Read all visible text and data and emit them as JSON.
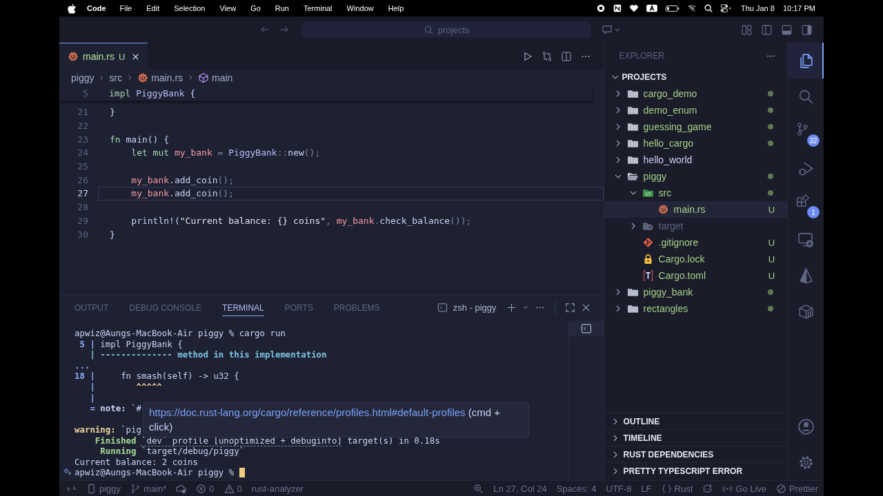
{
  "menu_bar": {
    "app": "Code",
    "items": [
      "File",
      "Edit",
      "Selection",
      "View",
      "Go",
      "Run",
      "Terminal",
      "Window",
      "Help"
    ],
    "date": "Thu Jan 8",
    "time": "10:17 PM"
  },
  "title_bar": {
    "search": "projects"
  },
  "editor_tabs": [
    {
      "label": "main.rs",
      "badge": "U",
      "kind": "rust",
      "selected": true
    }
  ],
  "breadcrumb": [
    {
      "label": "piggy",
      "kind": "folder"
    },
    {
      "label": "src",
      "kind": "folder"
    },
    {
      "label": "main.rs",
      "kind": "rust"
    },
    {
      "label": "main",
      "kind": "symbol"
    }
  ],
  "editor": {
    "sticky": {
      "number": "5",
      "tokens": [
        {
          "text": "impl ",
          "kind": "kw"
        },
        {
          "text": "PiggyBank",
          "kind": "type"
        },
        {
          "text": " {",
          "kind": "text"
        }
      ]
    },
    "lines": [
      {
        "number": "21",
        "current": false,
        "tokens": [
          {
            "text": "}",
            "kind": "text"
          }
        ]
      },
      {
        "number": "22",
        "current": false
      },
      {
        "number": "23",
        "current": false,
        "tokens": [
          {
            "text": "fn ",
            "kind": "kw"
          },
          {
            "text": "main",
            "kind": "fn"
          },
          {
            "text": "() {",
            "kind": "text"
          }
        ]
      },
      {
        "number": "24",
        "current": false,
        "tokens": [
          {
            "text": "    let mut ",
            "kind": "kw"
          },
          {
            "text": "my_bank",
            "kind": "var"
          },
          {
            "text": " = ",
            "kind": "punct"
          },
          {
            "text": "PiggyBank",
            "kind": "type"
          },
          {
            "text": "::",
            "kind": "punct"
          },
          {
            "text": "new",
            "kind": "fn"
          },
          {
            "text": "();",
            "kind": "punct"
          }
        ]
      },
      {
        "number": "25",
        "current": false
      },
      {
        "number": "26",
        "current": false,
        "tokens": [
          {
            "text": "    my_bank",
            "kind": "var"
          },
          {
            "text": ".add_coin",
            "kind": "fn"
          },
          {
            "text": "();",
            "kind": "punct"
          }
        ]
      },
      {
        "number": "27",
        "current": true,
        "tokens": [
          {
            "text": "    my_bank",
            "kind": "var"
          },
          {
            "text": ".add_coin",
            "kind": "fn"
          },
          {
            "text": "();",
            "kind": "punct"
          }
        ]
      },
      {
        "number": "28",
        "current": false
      },
      {
        "number": "29",
        "current": false,
        "tokens": [
          {
            "text": "    println!",
            "kind": "fn"
          },
          {
            "text": "(",
            "kind": "text"
          },
          {
            "text": "\"Current balance: {} coins\"",
            "kind": "str"
          },
          {
            "text": ", ",
            "kind": "punct"
          },
          {
            "text": "my_bank",
            "kind": "var"
          },
          {
            "text": ".",
            "kind": "punct"
          },
          {
            "text": "check_balance",
            "kind": "fn"
          },
          {
            "text": "());",
            "kind": "punct"
          }
        ]
      },
      {
        "number": "30",
        "current": false,
        "tokens": [
          {
            "text": "}",
            "kind": "text"
          }
        ]
      }
    ]
  },
  "panel": {
    "tabs": [
      {
        "label": "OUTPUT",
        "selected": false
      },
      {
        "label": "DEBUG CONSOLE",
        "selected": false
      },
      {
        "label": "TERMINAL",
        "selected": true
      },
      {
        "label": "PORTS",
        "selected": false
      },
      {
        "label": "PROBLEMS",
        "selected": false
      }
    ],
    "terminal_name": "zsh - piggy",
    "lines": [
      {
        "tokens": [
          {
            "text": "apwiz@Aungs-MacBook-Air piggy % cargo run",
            "kind": "text"
          }
        ]
      },
      {
        "tokens": [
          {
            "text": " 5 |",
            "kind": "gutter"
          },
          {
            "text": " impl PiggyBank {",
            "kind": "text"
          }
        ]
      },
      {
        "tokens": [
          {
            "text": "   | -------------- method in this implementation",
            "kind": "label"
          }
        ]
      },
      {
        "tokens": [
          {
            "text": "...",
            "kind": "gutter"
          }
        ]
      },
      {
        "tokens": [
          {
            "text": "18 |",
            "kind": "gutter"
          },
          {
            "text": "     fn smash(self) -> u32 {",
            "kind": "text"
          }
        ]
      },
      {
        "tokens": [
          {
            "text": "   |",
            "kind": "gutter"
          },
          {
            "text": "        ^^^^^",
            "kind": "caret"
          }
        ]
      },
      {
        "tokens": [
          {
            "text": "   |",
            "kind": "gutter"
          }
        ]
      },
      {
        "tokens": [
          {
            "text": "   =",
            "kind": "gutter"
          },
          {
            "text": " note:",
            "kind": "note"
          },
          {
            "text": " `#",
            "kind": "text"
          }
        ]
      },
      {
        "blank_before": true,
        "tokens": [
          {
            "text": "warning:",
            "kind": "warn"
          },
          {
            "text": " `pig",
            "kind": "text"
          }
        ]
      },
      {
        "tokens": [
          {
            "text": "    Finished ",
            "kind": "status"
          },
          {
            "text": "`dev` profile [unoptimized + debuginfo]",
            "kind": "hover"
          },
          {
            "text": " target(s) in 0.18s",
            "kind": "text"
          }
        ]
      },
      {
        "tokens": [
          {
            "text": "     Running",
            "kind": "status"
          },
          {
            "text": " `target/debug/piggy`",
            "kind": "text"
          }
        ]
      },
      {
        "tokens": [
          {
            "text": "Current balance: 2 coins",
            "kind": "text"
          }
        ]
      },
      {
        "tokens": [
          {
            "text": "apwiz@Aungs-MacBook-Air piggy % ",
            "kind": "text"
          }
        ],
        "cursor": true
      }
    ],
    "hover": {
      "link": "https://doc.rust-lang.org/cargo/reference/profiles.html#default-profiles",
      "hint": "(cmd + click)"
    }
  },
  "sidebar": {
    "title": "EXPLORER",
    "section": "PROJECTS",
    "tree": [
      {
        "name": "cargo_demo",
        "kind": "folder",
        "expanded": false,
        "selected": false,
        "modified": true
      },
      {
        "name": "demo_enum",
        "kind": "folder",
        "expanded": false,
        "selected": false,
        "modified": true
      },
      {
        "name": "guessing_game",
        "kind": "folder",
        "expanded": false,
        "selected": false,
        "modified": true
      },
      {
        "name": "hello_cargo",
        "kind": "folder",
        "expanded": false,
        "selected": false,
        "modified": true
      },
      {
        "name": "hello_world",
        "kind": "folder",
        "expanded": false,
        "selected": false
      },
      {
        "name": "piggy",
        "kind": "folder",
        "expanded": true,
        "selected": false,
        "modified": true,
        "children": [
          {
            "name": "src",
            "kind": "src",
            "expanded": true,
            "selected": false,
            "modified": true,
            "children": [
              {
                "name": "main.rs",
                "kind": "rust",
                "selected": true,
                "untracked": true,
                "badge": "U"
              }
            ]
          },
          {
            "name": "target",
            "kind": "target",
            "expanded": false,
            "selected": false,
            "ignored": true
          },
          {
            "name": ".gitignore",
            "kind": "git",
            "selected": false,
            "untracked": true,
            "badge": "U"
          },
          {
            "name": "Cargo.lock",
            "kind": "lock",
            "selected": false,
            "untracked": true,
            "badge": "U"
          },
          {
            "name": "Cargo.toml",
            "kind": "toml",
            "selected": false,
            "untracked": true,
            "badge": "U"
          }
        ]
      },
      {
        "name": "piggy_bank",
        "kind": "folder",
        "expanded": false,
        "selected": false,
        "modified": true
      },
      {
        "name": "rectangles",
        "kind": "folder",
        "expanded": false,
        "selected": false,
        "modified": true
      }
    ],
    "sections": [
      {
        "label": "OUTLINE",
        "expanded": false
      },
      {
        "label": "TIMELINE",
        "expanded": false
      },
      {
        "label": "RUST DEPENDENCIES",
        "expanded": false
      },
      {
        "label": "PRETTY TYPESCRIPT ERROR",
        "expanded": false
      }
    ]
  },
  "activity_bar": {
    "top": [
      {
        "kind": "explorer",
        "selected": true
      },
      {
        "kind": "search",
        "selected": false
      },
      {
        "kind": "scm",
        "selected": false,
        "badge": "32"
      },
      {
        "kind": "debug",
        "selected": false
      },
      {
        "kind": "extensions",
        "selected": false,
        "badge": "1"
      },
      {
        "kind": "remote",
        "selected": false
      },
      {
        "kind": "pyramid",
        "selected": false
      },
      {
        "kind": "box",
        "selected": false
      }
    ],
    "bottom": [
      {
        "kind": "account",
        "selected": false
      },
      {
        "kind": "settings",
        "selected": false
      }
    ]
  },
  "status_bar": {
    "left": [
      {
        "kind": "remote"
      },
      {
        "kind": "device",
        "text": "piggy"
      },
      {
        "kind": "branch",
        "text": "main*"
      },
      {
        "kind": "sync"
      },
      {
        "kind": "error",
        "text": "0"
      },
      {
        "kind": "warning",
        "text": "0"
      },
      {
        "kind": "plain",
        "text": "rust-analyzer"
      }
    ],
    "right": [
      {
        "kind": "zoom"
      },
      {
        "kind": "plain",
        "text": "Ln 27, Col 24"
      },
      {
        "kind": "plain",
        "text": "Spaces: 4"
      },
      {
        "kind": "plain",
        "text": "UTF-8"
      },
      {
        "kind": "plain",
        "text": "LF"
      },
      {
        "kind": "braces",
        "text": "Rust"
      },
      {
        "kind": "copilot"
      },
      {
        "kind": "broadcast",
        "text": "Go Live"
      },
      {
        "kind": "blocked",
        "text": "Prettier"
      }
    ]
  }
}
